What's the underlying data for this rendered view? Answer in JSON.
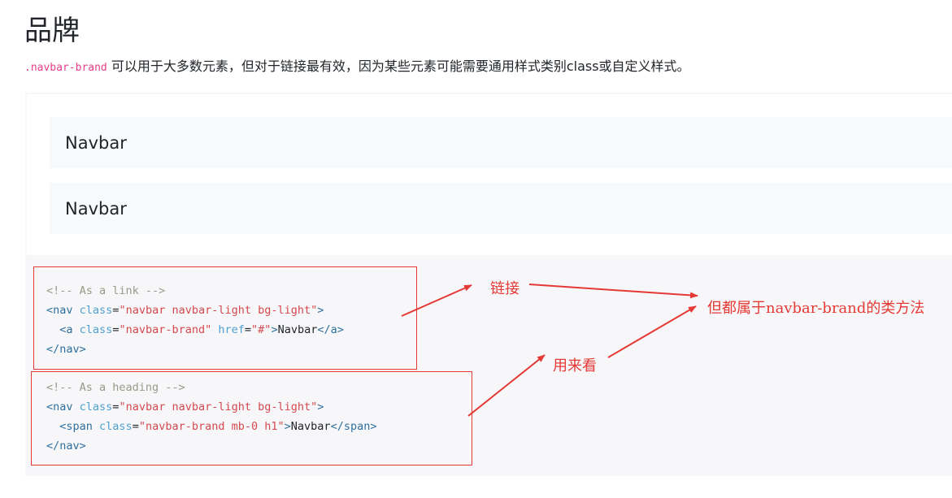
{
  "heading": "品牌",
  "intro": {
    "code": ".navbar-brand",
    "text": " 可以用于大多数元素，但对于链接最有效，因为某些元素可能需要通用样式类别class或自定义样式。"
  },
  "example": {
    "brand1": "Navbar",
    "brand2": "Navbar"
  },
  "code1": {
    "comment": "<!-- As a link -->",
    "nav_open": "<nav",
    "nav_class_attr": "class",
    "nav_class_val": "\"navbar navbar-light bg-light\"",
    "gt": ">",
    "a_open": "<a",
    "a_class_attr": "class",
    "a_class_val": "\"navbar-brand\"",
    "href_attr": "href",
    "href_val": "\"#\"",
    "a_text": "Navbar",
    "a_close": "</a>",
    "nav_close": "</nav>"
  },
  "code2": {
    "comment": "<!-- As a heading -->",
    "nav_open": "<nav",
    "nav_class_attr": "class",
    "nav_class_val": "\"navbar navbar-light bg-light\"",
    "gt": ">",
    "span_open": "<span",
    "span_class_attr": "class",
    "span_class_val": "\"navbar-brand mb-0 h1\"",
    "span_text": "Navbar",
    "span_close": "</span>",
    "nav_close": "</nav>"
  },
  "annotations": {
    "link": "链接",
    "heading": "用来看",
    "both": "但都属于navbar-brand的类方法"
  },
  "colors": {
    "annotation": "#e53935",
    "code_string": "#d44950",
    "code_tag": "#2f6f9f",
    "code_comment": "#999988",
    "inline_code": "#e83e8c"
  }
}
